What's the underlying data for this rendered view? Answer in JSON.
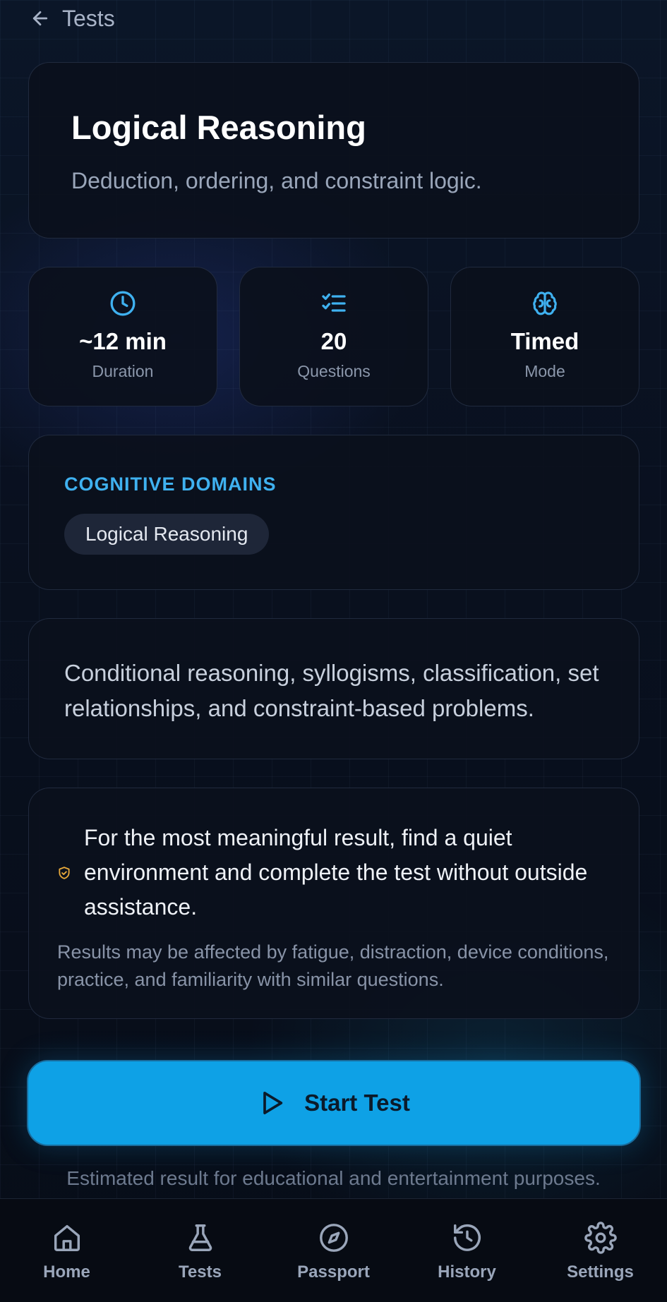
{
  "header": {
    "title": "Tests",
    "back_icon": "arrow-left-icon"
  },
  "test": {
    "title": "Logical Reasoning",
    "subtitle": "Deduction, ordering, and constraint logic."
  },
  "stats": [
    {
      "icon": "clock-icon",
      "value": "~12 min",
      "label": "Duration"
    },
    {
      "icon": "checklist-icon",
      "value": "20",
      "label": "Questions"
    },
    {
      "icon": "brain-icon",
      "value": "Timed",
      "label": "Mode"
    }
  ],
  "domains": {
    "heading": "COGNITIVE DOMAINS",
    "chips": [
      "Logical Reasoning"
    ]
  },
  "description": "Conditional reasoning, syllogisms, classification, set relationships, and constraint-based problems.",
  "notice": {
    "icon": "shield-icon",
    "main": "For the most meaningful result, find a quiet environment and complete the test without outside assistance.",
    "sub": "Results may be affected by fatigue, distraction, device conditions, practice, and familiarity with similar questions."
  },
  "start_button": {
    "label": "Start Test",
    "icon": "play-icon"
  },
  "disclaimer": "Estimated result for educational and entertainment purposes.",
  "nav": [
    {
      "icon": "home-icon",
      "label": "Home"
    },
    {
      "icon": "flask-icon",
      "label": "Tests"
    },
    {
      "icon": "compass-icon",
      "label": "Passport"
    },
    {
      "icon": "history-icon",
      "label": "History"
    },
    {
      "icon": "gear-icon",
      "label": "Settings"
    }
  ],
  "colors": {
    "accent": "#3fb1f0",
    "button": "#0ea1e6",
    "warning": "#e8a93a",
    "background": "#070b14"
  }
}
